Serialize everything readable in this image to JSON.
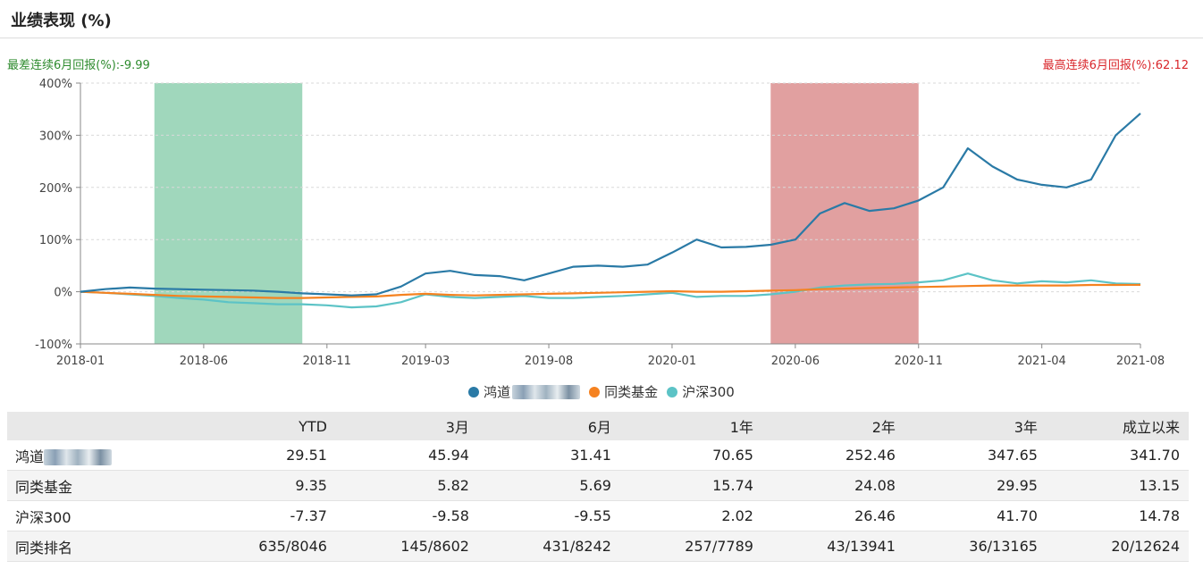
{
  "header": {
    "title": "业绩表现 (%)"
  },
  "stats": {
    "worst": "最差连续6月回报(%):-9.99",
    "best": "最高连续6月回报(%):62.12"
  },
  "colors": {
    "fund": "#2a7aa6",
    "peer": "#f58220",
    "index": "#5cc3c6",
    "worst_band": "#8fd0b0",
    "best_band": "#dc8f8f"
  },
  "chart_data": {
    "type": "line",
    "ylim": [
      -100,
      400
    ],
    "yticks": [
      -100,
      0,
      100,
      200,
      300,
      400
    ],
    "ytick_labels": [
      "-100%",
      "0%",
      "100%",
      "200%",
      "300%",
      "400%"
    ],
    "xlim": [
      "2018-01",
      "2021-08"
    ],
    "xticks": [
      "2018-01",
      "2018-06",
      "2018-11",
      "2019-03",
      "2019-08",
      "2020-01",
      "2020-06",
      "2020-11",
      "2021-04",
      "2021-08"
    ],
    "grid": true,
    "legend_position": "bottom",
    "bands": [
      {
        "start": "2018-04",
        "end": "2018-10",
        "kind": "worst"
      },
      {
        "start": "2020-05",
        "end": "2020-11",
        "kind": "best"
      }
    ],
    "x": [
      "2018-01",
      "2018-02",
      "2018-03",
      "2018-04",
      "2018-05",
      "2018-06",
      "2018-07",
      "2018-08",
      "2018-09",
      "2018-10",
      "2018-11",
      "2018-12",
      "2019-01",
      "2019-02",
      "2019-03",
      "2019-04",
      "2019-05",
      "2019-06",
      "2019-07",
      "2019-08",
      "2019-09",
      "2019-10",
      "2019-11",
      "2019-12",
      "2020-01",
      "2020-02",
      "2020-03",
      "2020-04",
      "2020-05",
      "2020-06",
      "2020-07",
      "2020-08",
      "2020-09",
      "2020-10",
      "2020-11",
      "2020-12",
      "2021-01",
      "2021-02",
      "2021-03",
      "2021-04",
      "2021-05",
      "2021-06",
      "2021-07",
      "2021-08"
    ],
    "series": [
      {
        "name": "鸿道",
        "key": "fund",
        "values": [
          0,
          5,
          8,
          6,
          5,
          4,
          3,
          2,
          0,
          -3,
          -5,
          -7,
          -5,
          10,
          35,
          40,
          32,
          30,
          22,
          35,
          48,
          50,
          48,
          52,
          75,
          100,
          85,
          86,
          90,
          100,
          150,
          170,
          155,
          160,
          175,
          200,
          275,
          240,
          215,
          205,
          200,
          215,
          300,
          341.7
        ]
      },
      {
        "name": "同类基金",
        "key": "peer",
        "values": [
          0,
          -2,
          -4,
          -6,
          -8,
          -9,
          -10,
          -11,
          -12,
          -12,
          -11,
          -10,
          -9,
          -6,
          -4,
          -6,
          -7,
          -6,
          -5,
          -4,
          -3,
          -2,
          -1,
          0,
          1,
          0,
          0,
          1,
          2,
          3,
          5,
          6,
          7,
          8,
          9,
          10,
          11,
          12,
          12,
          12,
          12,
          13,
          13,
          13.15
        ]
      },
      {
        "name": "沪深300",
        "key": "index",
        "values": [
          0,
          -2,
          -5,
          -8,
          -12,
          -15,
          -20,
          -22,
          -24,
          -24,
          -26,
          -30,
          -28,
          -20,
          -5,
          -10,
          -12,
          -10,
          -8,
          -12,
          -12,
          -10,
          -8,
          -5,
          -2,
          -10,
          -8,
          -8,
          -5,
          0,
          8,
          12,
          14,
          15,
          18,
          22,
          35,
          22,
          16,
          20,
          18,
          22,
          16,
          14.78
        ]
      }
    ]
  },
  "legend": [
    {
      "key": "fund",
      "label": "鸿道",
      "redacted": true
    },
    {
      "key": "peer",
      "label": "同类基金",
      "redacted": false
    },
    {
      "key": "index",
      "label": "沪深300",
      "redacted": false
    }
  ],
  "table": {
    "headers": [
      "",
      "YTD",
      "3月",
      "6月",
      "1年",
      "2年",
      "3年",
      "成立以来"
    ],
    "rows": [
      {
        "name": "鸿道",
        "redacted": true,
        "cells": [
          "29.51",
          "45.94",
          "31.41",
          "70.65",
          "252.46",
          "347.65",
          "341.70"
        ]
      },
      {
        "name": "同类基金",
        "redacted": false,
        "cells": [
          "9.35",
          "5.82",
          "5.69",
          "15.74",
          "24.08",
          "29.95",
          "13.15"
        ]
      },
      {
        "name": "沪深300",
        "redacted": false,
        "cells": [
          "-7.37",
          "-9.58",
          "-9.55",
          "2.02",
          "26.46",
          "41.70",
          "14.78"
        ]
      },
      {
        "name": "同类排名",
        "redacted": false,
        "cells": [
          "635/8046",
          "145/8602",
          "431/8242",
          "257/7789",
          "43/13941",
          "36/13165",
          "20/12624"
        ]
      }
    ]
  }
}
